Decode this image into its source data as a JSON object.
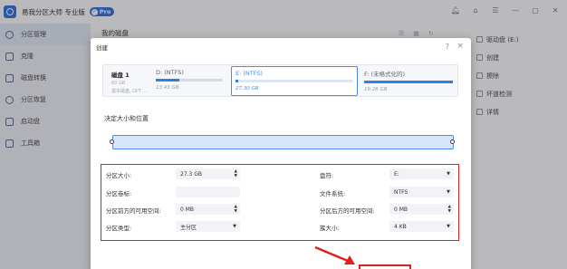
{
  "app": {
    "title": "易我分区大师 专业版",
    "badge": "Pro"
  },
  "window_icons": [
    "bell-icon",
    "shirt-icon",
    "menu-icon",
    "minimize-icon",
    "maximize-icon",
    "close-icon"
  ],
  "sidebar": {
    "items": [
      {
        "label": "分区管理",
        "icon": "partition-manage-icon",
        "active": true
      },
      {
        "label": "克隆",
        "icon": "clone-icon",
        "active": false
      },
      {
        "label": "磁盘转换",
        "icon": "disk-convert-icon",
        "active": false
      },
      {
        "label": "分区恢复",
        "icon": "partition-recovery-icon",
        "active": false
      },
      {
        "label": "启动盘",
        "icon": "boot-disk-icon",
        "active": false
      },
      {
        "label": "工具箱",
        "icon": "toolbox-icon",
        "active": false
      }
    ]
  },
  "main": {
    "title": "我的磁盘"
  },
  "right_panel": {
    "items": [
      {
        "label": "驱动盘 (E:)"
      },
      {
        "label": "创建"
      },
      {
        "label": "擦除"
      },
      {
        "label": "坏道检测"
      },
      {
        "label": "详情"
      }
    ]
  },
  "dialog": {
    "title": "创建",
    "help": "?",
    "close": "×",
    "disk": {
      "name": "磁盘 1",
      "size": "60 GB",
      "type": "基本磁盘, GPT ..."
    },
    "partitions": [
      {
        "name": "D: (NTFS)",
        "size": "13.43 GB",
        "fill": 0.35,
        "selected": false
      },
      {
        "name": "E: (NTFS)",
        "size": "27.30 GB",
        "fill": 0.02,
        "selected": true
      },
      {
        "name": "F: (未格式化的)",
        "size": "19.26 GB",
        "fill": 1.0,
        "selected": false
      }
    ],
    "size_section_title": "决定大小和位置",
    "fields": {
      "partition_size_label": "分区大小:",
      "partition_size_value": "27.3 GB",
      "drive_letter_label": "盘符:",
      "drive_letter_value": "E:",
      "volume_label_label": "分区卷标:",
      "volume_label_value": "",
      "filesystem_label": "文件系统:",
      "filesystem_value": "NTFS",
      "space_before_label": "分区前方的可用空间:",
      "space_before_value": "0 MB",
      "space_after_label": "分区后方的可用空间:",
      "space_after_value": "0 MB",
      "partition_type_label": "分区类型:",
      "partition_type_value": "主分区",
      "cluster_size_label": "簇大小:",
      "cluster_size_value": "4 KB"
    }
  },
  "colors": {
    "accent": "#2f7fe0",
    "highlight_red": "#e02020"
  }
}
